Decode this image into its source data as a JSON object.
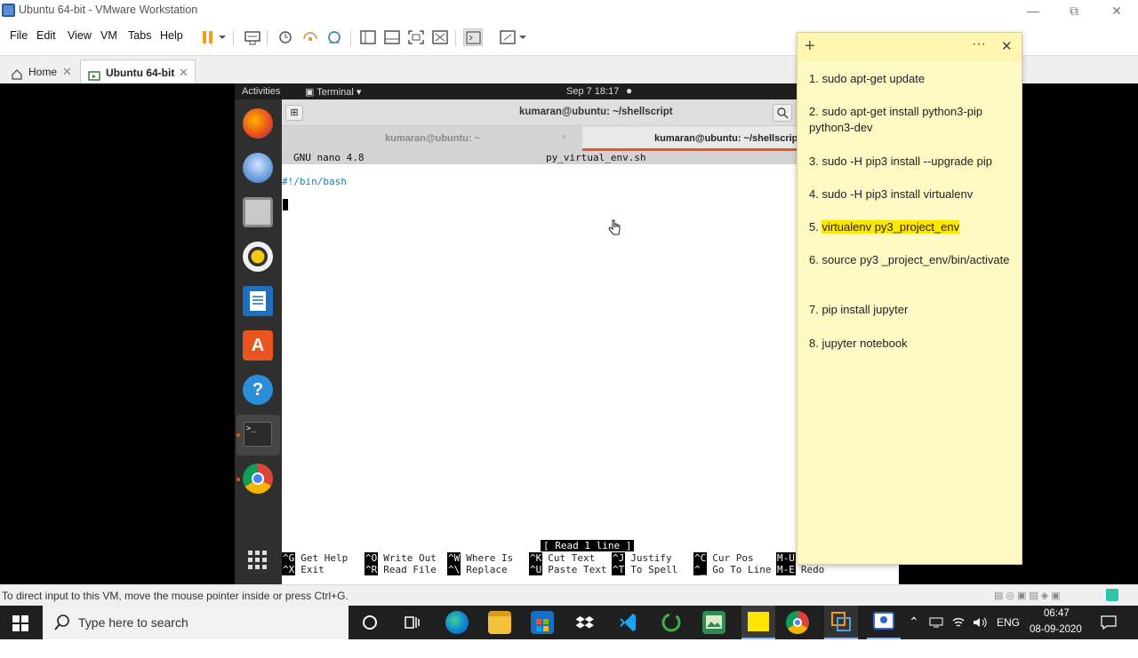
{
  "window": {
    "title": "Ubuntu 64-bit - VMware Workstation"
  },
  "menu": {
    "items": [
      "File",
      "Edit",
      "View",
      "VM",
      "Tabs",
      "Help"
    ]
  },
  "tabs": {
    "home_label": "Home",
    "vm_label": "Ubuntu 64-bit"
  },
  "gnome": {
    "activities": "Activities",
    "app_menu": "Terminal",
    "clock": "Sep 7  18:17"
  },
  "terminal": {
    "title": "kumaran@ubuntu: ~/shellscript",
    "tab1": "kumaran@ubuntu: ~",
    "tab2": "kumaran@ubuntu: ~/shellscript"
  },
  "nano": {
    "version": "GNU nano 4.8",
    "filename": "py_virtual_env.sh",
    "line1": "#!/bin/bash",
    "status": "[ Read 1 line ]",
    "shortcuts": [
      {
        "key1": "^G",
        "label1": "Get Help",
        "key2": "^X",
        "label2": "Exit"
      },
      {
        "key1": "^O",
        "label1": "Write Out",
        "key2": "^R",
        "label2": "Read File"
      },
      {
        "key1": "^W",
        "label1": "Where Is",
        "key2": "^\\",
        "label2": "Replace"
      },
      {
        "key1": "^K",
        "label1": "Cut Text",
        "key2": "^U",
        "label2": "Paste Text"
      },
      {
        "key1": "^J",
        "label1": "Justify",
        "key2": "^T",
        "label2": "To Spell"
      },
      {
        "key1": "^C",
        "label1": "Cur Pos",
        "key2": "^_",
        "label2": "Go To Line"
      },
      {
        "key1": "M-U",
        "label1": "",
        "key2": "M-E",
        "label2": "Redo"
      }
    ]
  },
  "sticky": {
    "lines": [
      "1. sudo apt-get update",
      "2. sudo apt-get install python3-pip python3-dev",
      "3. sudo -H pip3 install --upgrade pip",
      "4. sudo -H pip3 install virtualenv",
      "5. ",
      "6. source  py3 _project_env/bin/activate",
      "7. pip install jupyter",
      "8. jupyter notebook"
    ],
    "highlight": "virtualenv py3_project_env"
  },
  "status": {
    "message": "To direct input to this VM, move the mouse pointer inside or press Ctrl+G."
  },
  "taskbar": {
    "search_placeholder": "Type here to search",
    "lang": "ENG",
    "time": "06:47",
    "date": "08-09-2020"
  },
  "colors": {
    "ubuntu_dock": "#2f2f2f",
    "sticky_bg": "#fff9c4",
    "highlight": "#ffe600",
    "taskbar": "#1f1f1f",
    "pause_orange": "#f39c12"
  }
}
